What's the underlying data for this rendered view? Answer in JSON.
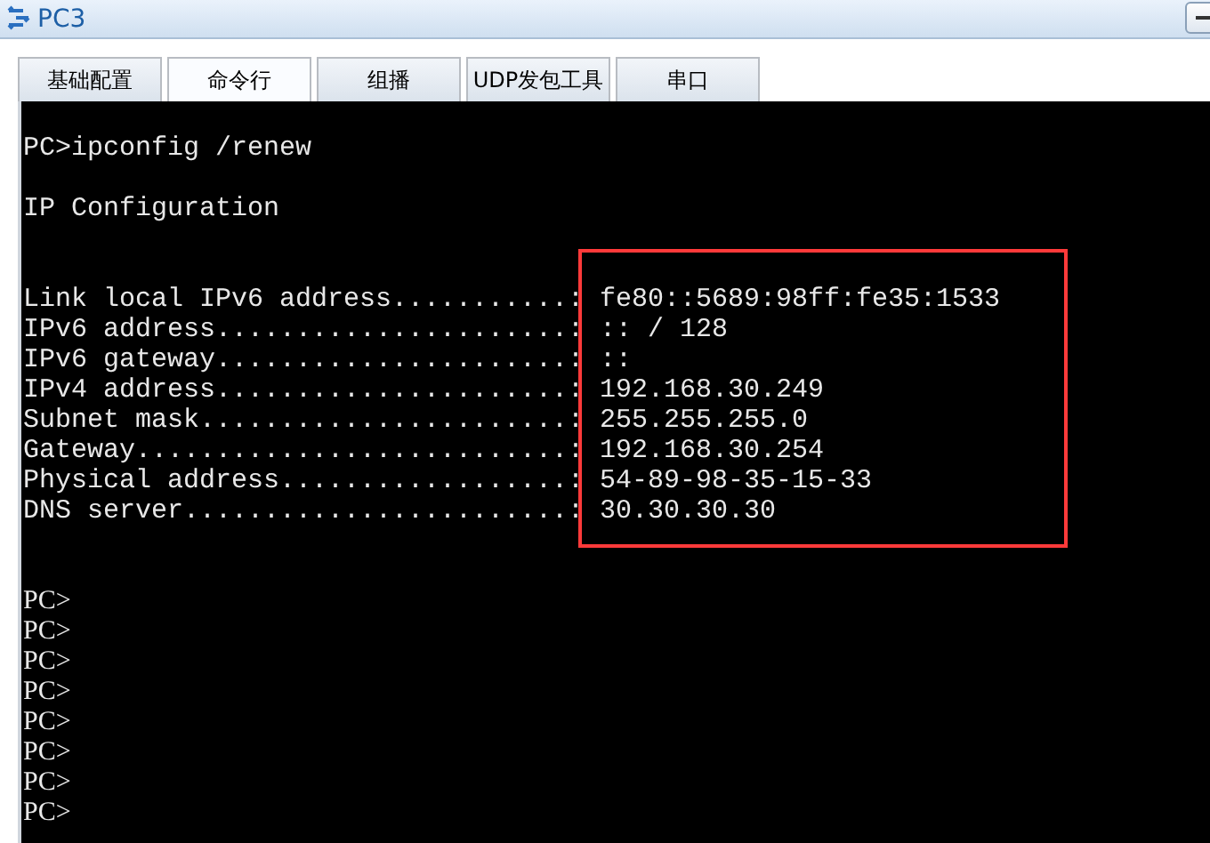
{
  "window": {
    "title": "PC3"
  },
  "tabs": [
    {
      "label": "基础配置",
      "selected": false
    },
    {
      "label": "命令行",
      "selected": true
    },
    {
      "label": "组播",
      "selected": false
    },
    {
      "label": "UDP发包工具",
      "selected": false
    },
    {
      "label": "串口",
      "selected": false
    }
  ],
  "terminal": {
    "command": "PC>ipconfig /renew",
    "heading": "IP Configuration",
    "entries": [
      {
        "label": "Link local IPv6 address...........:",
        "value": "fe80::5689:98ff:fe35:1533"
      },
      {
        "label": "IPv6 address......................:",
        "value": ":: / 128"
      },
      {
        "label": "IPv6 gateway......................:",
        "value": "::"
      },
      {
        "label": "IPv4 address......................:",
        "value": "192.168.30.249"
      },
      {
        "label": "Subnet mask.......................:",
        "value": "255.255.255.0"
      },
      {
        "label": "Gateway...........................:",
        "value": "192.168.30.254"
      },
      {
        "label": "Physical address..................:",
        "value": "54-89-98-35-15-33"
      },
      {
        "label": "DNS server........................:",
        "value": "30.30.30.30"
      }
    ],
    "prompts": [
      "PC>",
      "PC>",
      "PC>",
      "PC>",
      "PC>",
      "PC>",
      "PC>",
      "PC>"
    ]
  }
}
